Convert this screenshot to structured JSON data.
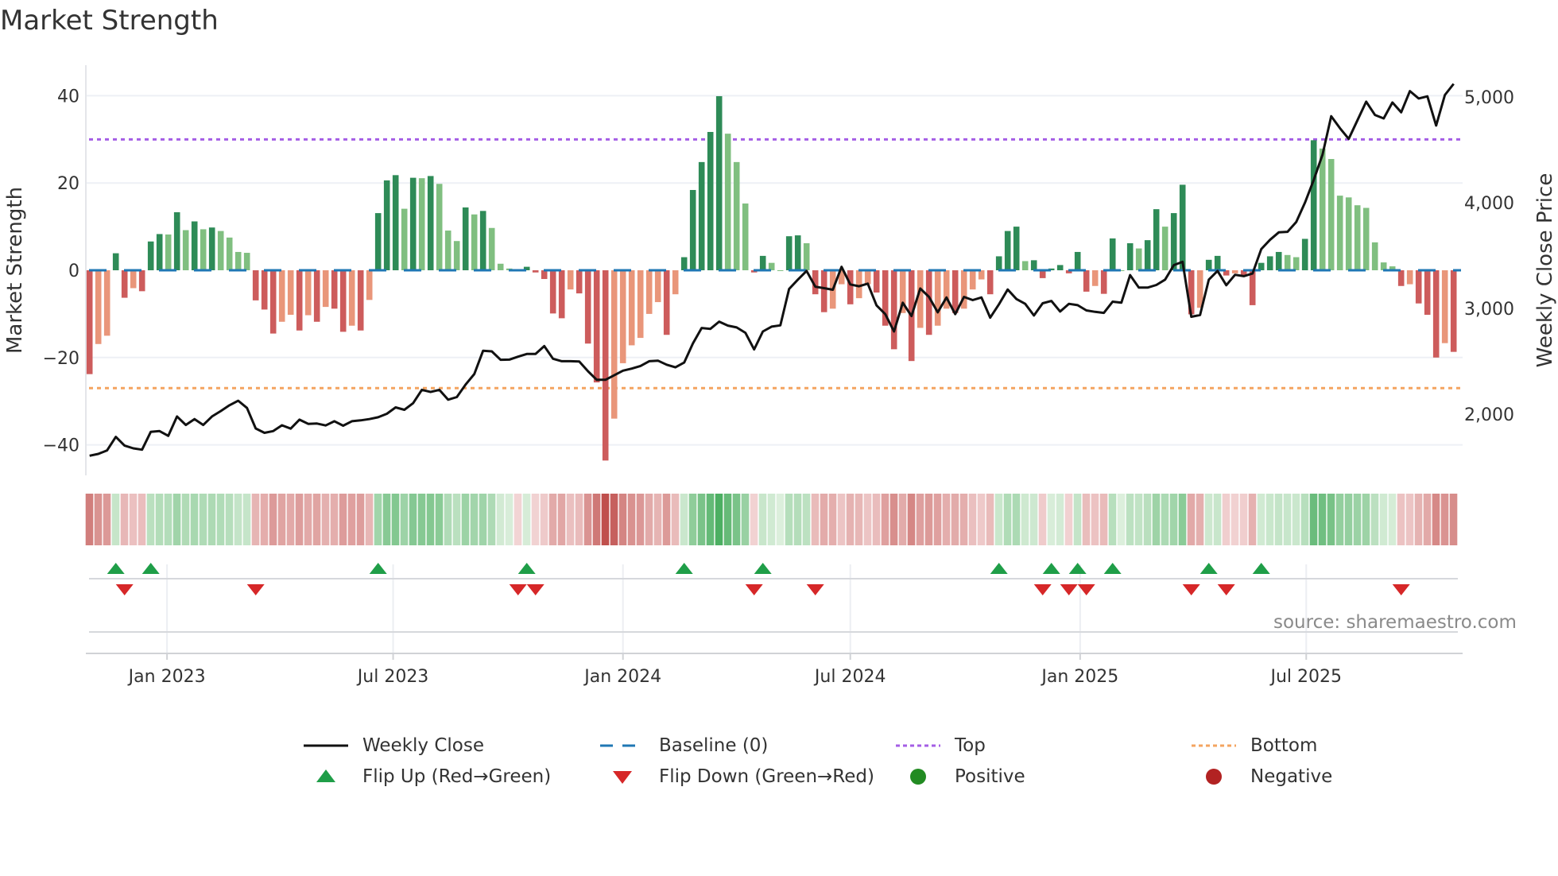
{
  "title": "Market Strength",
  "source": "source: sharemaestro.com",
  "colors": {
    "pos_rising": "#2e8b57",
    "pos_falling": "#80bf80",
    "neg_falling": "#cd5c5c",
    "neg_rising": "#e9967a",
    "baseline": "#1f77b4",
    "top": "#a45ee5",
    "bottom": "#f4a460",
    "flip_up": "#1f9e48",
    "flip_down": "#d62728",
    "close": "#111111"
  },
  "legend": {
    "weekly_close": "Weekly Close",
    "baseline": "Baseline (0)",
    "top": "Top",
    "bottom": "Bottom",
    "flip_up": "Flip Up (Red→Green)",
    "flip_down": "Flip Down (Green→Red)",
    "positive": "Positive",
    "negative": "Negative"
  },
  "chart_data": {
    "type": "bar",
    "title": "Market Strength",
    "ylabel": "Market Strength",
    "y2label": "Weekly Close Price",
    "ylim": [
      -47,
      47
    ],
    "y2lim": [
      1420,
      5300
    ],
    "yticks": [
      40,
      20,
      0,
      -20,
      -40
    ],
    "ytick_labels": [
      "40",
      "20",
      "0",
      "−20",
      "−40"
    ],
    "y2ticks": [
      5000,
      4000,
      3000,
      2000
    ],
    "y2tick_labels": [
      "5,000",
      "4,000",
      "3,000",
      "2,000"
    ],
    "start_date": "2022-10-31",
    "frequency": "weekly",
    "xticks": [
      {
        "date": "2023-01-01",
        "label": "Jan 2023"
      },
      {
        "date": "2023-07-01",
        "label": "Jul 2023"
      },
      {
        "date": "2024-01-01",
        "label": "Jan 2024"
      },
      {
        "date": "2024-07-01",
        "label": "Jul 2024"
      },
      {
        "date": "2025-01-01",
        "label": "Jan 2025"
      },
      {
        "date": "2025-07-01",
        "label": "Jul 2025"
      }
    ],
    "top_level": 30,
    "bottom_level": -27,
    "baseline": 0,
    "strength": [
      -23.8,
      -16.9,
      -15,
      3.9,
      -6.3,
      -4.1,
      -4.8,
      6.6,
      8.3,
      8.2,
      13.3,
      9.2,
      11.2,
      9.4,
      9.8,
      9.0,
      7.5,
      4.2,
      4.0,
      -6.9,
      -9.0,
      -14.5,
      -11.8,
      -10.2,
      -13.8,
      -10.3,
      -11.8,
      -8.4,
      -8.8,
      -14.1,
      -12.7,
      -13.8,
      -6.8,
      13.1,
      20.6,
      21.8,
      14.1,
      21.2,
      21.1,
      21.6,
      19.8,
      9.1,
      6.7,
      14.4,
      12.8,
      13.6,
      9.7,
      1.5,
      0.4,
      -0.2,
      0.8,
      -0.5,
      -2,
      -9.9,
      -11,
      -4.4,
      -5.3,
      -16.8,
      -25.7,
      -43.6,
      -34,
      -21.3,
      -17.2,
      -15.5,
      -10,
      -7.3,
      -14.8,
      -5.5,
      3,
      18.4,
      24.8,
      31.7,
      39.9,
      31.3,
      24.8,
      15.3,
      -0.5,
      3.3,
      1.7,
      0,
      7.8,
      8.0,
      6.2,
      -5.5,
      -9.6,
      -8.8,
      -3.2,
      -7.8,
      -6.4,
      -3.2,
      -5.1,
      -12.7,
      -18.1,
      -9.8,
      -20.8,
      -13.2,
      -14.8,
      -12.7,
      -8.8,
      -9.8,
      -8.8,
      -4.4,
      -2.1,
      -5.5,
      3.2,
      9,
      10,
      2.1,
      2.3,
      -1.8,
      0.4,
      1.2,
      -0.7,
      4.2,
      -4.9,
      -3.6,
      -5.4,
      7.3,
      0,
      6.2,
      5.0,
      6.9,
      14.0,
      10,
      13.1,
      19.6,
      -10.1,
      -8.6,
      2.4,
      3.3,
      -1.2,
      -0.7,
      -1.1,
      -8,
      1.7,
      3.2,
      4.2,
      3.5,
      3.0,
      7.2,
      29.8,
      27.9,
      25.5,
      17.1,
      16.7,
      14.9,
      14.3,
      6.4,
      1.8,
      0.9,
      -3.6,
      -3.2,
      -7.6,
      -10.2,
      -20,
      -16.7,
      -18.7
    ],
    "weekly_close": [
      1606,
      1623,
      1656,
      1784,
      1701,
      1676,
      1663,
      1832,
      1839,
      1794,
      1977,
      1897,
      1952,
      1897,
      1977,
      2028,
      2083,
      2126,
      2058,
      1864,
      1822,
      1839,
      1894,
      1862,
      1947,
      1907,
      1910,
      1892,
      1932,
      1890,
      1932,
      1940,
      1952,
      1970,
      2003,
      2063,
      2040,
      2103,
      2229,
      2209,
      2229,
      2136,
      2161,
      2279,
      2379,
      2598,
      2593,
      2513,
      2515,
      2543,
      2568,
      2568,
      2643,
      2523,
      2500,
      2500,
      2497,
      2405,
      2324,
      2324,
      2367,
      2410,
      2430,
      2455,
      2500,
      2505,
      2467,
      2442,
      2487,
      2668,
      2814,
      2806,
      2874,
      2837,
      2819,
      2769,
      2611,
      2781,
      2827,
      2839,
      3183,
      3271,
      3354,
      3204,
      3191,
      3176,
      3392,
      3226,
      3209,
      3234,
      3028,
      2945,
      2781,
      3053,
      2927,
      3188,
      3108,
      2962,
      3103,
      2945,
      3108,
      3078,
      3103,
      2912,
      3038,
      3178,
      3088,
      3043,
      2932,
      3048,
      3070,
      2970,
      3043,
      3030,
      2980,
      2967,
      2957,
      3063,
      3053,
      3314,
      3196,
      3196,
      3221,
      3271,
      3409,
      3440,
      2920,
      2937,
      3271,
      3354,
      3219,
      3317,
      3304,
      3329,
      3560,
      3648,
      3719,
      3724,
      3817,
      4000,
      4214,
      4452,
      4817,
      4704,
      4603,
      4779,
      4955,
      4829,
      4796,
      4947,
      4854,
      5055,
      4985,
      5005,
      4729,
      5018,
      5123
    ],
    "flip_up_weeks": [
      3,
      7,
      33,
      50,
      68,
      77,
      104,
      110,
      113,
      117,
      128,
      134
    ],
    "flip_down_weeks": [
      4,
      19,
      49,
      51,
      76,
      83,
      109,
      112,
      114,
      126,
      130,
      150
    ]
  }
}
